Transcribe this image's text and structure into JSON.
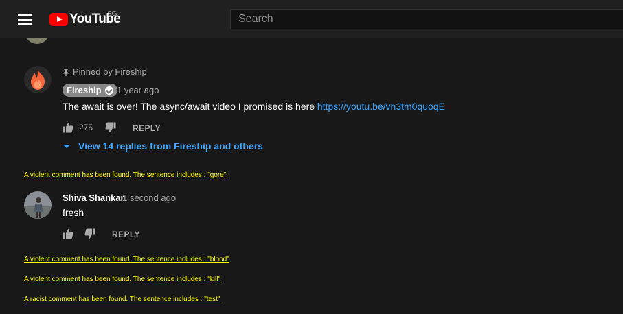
{
  "header": {
    "logo_text": "YouTube",
    "country_code": "SG",
    "search_placeholder": "Search"
  },
  "comments": [
    {
      "pinned_label": "Pinned by Fireship",
      "author": "Fireship",
      "verified": true,
      "time": "1 year ago",
      "text": "The await is over! The async/await video I promised is here ",
      "link_text": "https://youtu.be/vn3tm0quoqE",
      "likes": "275",
      "reply_label": "REPLY",
      "view_replies": "View 14 replies from Fireship and others"
    },
    {
      "author": "Shiva Shankar",
      "time": "1 second ago",
      "text": "fresh",
      "reply_label": "REPLY"
    }
  ],
  "warnings": [
    "A violent comment has been found. The sentence includes : \"gore\"",
    "A violent comment has been found. The sentence includes : \"blood\"",
    "A violent comment has been found. The sentence includes : \"kill\"",
    "A racist comment has been found. The sentence includes : \"test\""
  ],
  "colors": {
    "background": "#181818",
    "link": "#3ea6ff",
    "warning": "#ffff00",
    "brand_red": "#ff0000"
  }
}
